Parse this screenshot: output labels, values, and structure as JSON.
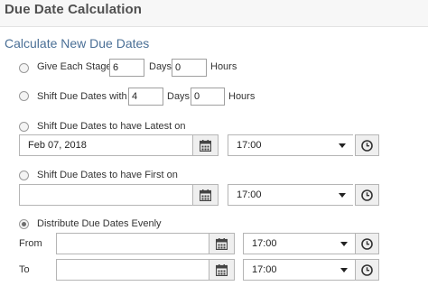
{
  "header": {
    "title": "Due Date Calculation"
  },
  "section": {
    "title": "Calculate New Due Dates"
  },
  "options": {
    "give_each_stage": {
      "label": "Give Each Stage",
      "days_value": "6",
      "days_label": "Days",
      "hours_value": "0",
      "hours_label": "Hours",
      "selected": false
    },
    "shift_with": {
      "label": "Shift Due Dates with",
      "days_value": "4",
      "days_label": "Days",
      "hours_value": "0",
      "hours_label": "Hours",
      "selected": false
    },
    "latest_on": {
      "label": "Shift Due Dates to have Latest on",
      "date_value": "Feb 07, 2018",
      "time_value": "17:00",
      "selected": false
    },
    "first_on": {
      "label": "Shift Due Dates to have First on",
      "date_value": "",
      "time_value": "17:00",
      "selected": false
    },
    "distribute": {
      "label": "Distribute Due Dates Evenly",
      "selected": true,
      "from_label": "From",
      "from_date_value": "",
      "from_time_value": "17:00",
      "to_label": "To",
      "to_date_value": "",
      "to_time_value": "17:00"
    }
  },
  "icons": {
    "calendar": "calendar-icon",
    "clock": "clock-icon",
    "dropdown": "chevron-down-icon"
  },
  "colors": {
    "section_title": "#4a6f96",
    "header_text": "#505050",
    "button_bg": "#efefef"
  }
}
